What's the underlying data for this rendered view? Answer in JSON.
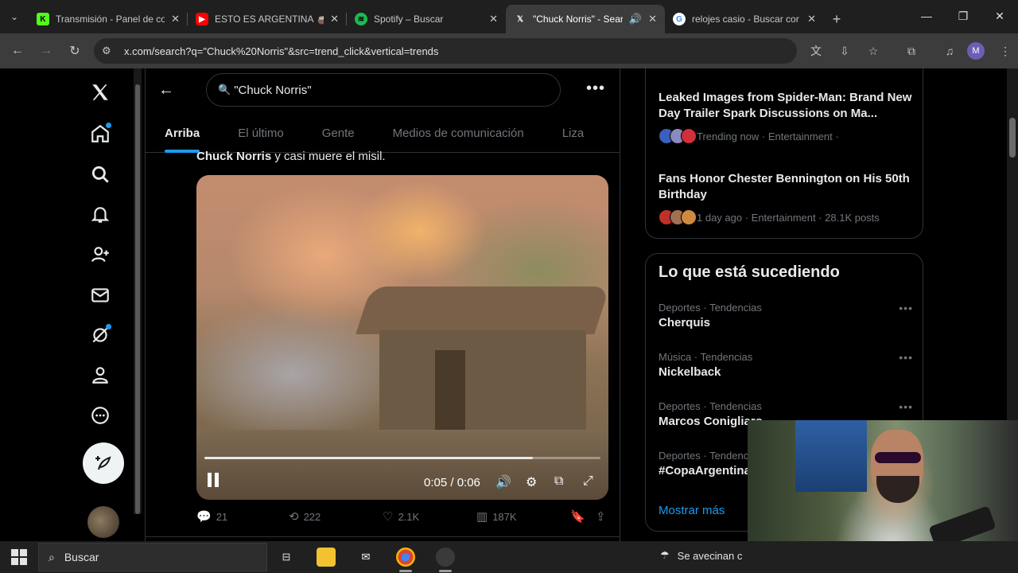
{
  "browser": {
    "tabs": [
      {
        "label": "Transmisión - Panel de co",
        "icon": "kick-icon",
        "color": "#53fc18",
        "active": false
      },
      {
        "label": "ESTO ES ARGENTINA 🧉🧉",
        "icon": "youtube-icon",
        "color": "#ff0000",
        "active": false
      },
      {
        "label": "Spotify – Buscar",
        "icon": "spotify-icon",
        "color": "#1db954",
        "active": false
      },
      {
        "label": "\"Chuck Norris\" - Sear",
        "icon": "x-icon",
        "color": "#ffffff",
        "active": true
      },
      {
        "label": "relojes casio - Buscar cor",
        "icon": "google-icon",
        "color": "#4285f4",
        "active": false
      }
    ],
    "url": "x.com/search?q=\"Chuck%20Norris\"&src=trend_click&vertical=trends",
    "profile_initial": "M"
  },
  "search": {
    "query": "\"Chuck Norris\"",
    "tabs": [
      "Arriba",
      "El último",
      "Gente",
      "Medios de comunicación",
      "Liza"
    ]
  },
  "post": {
    "text_bold": "Chuck Norris",
    "text_rest": " y casi muere el misil.",
    "video": {
      "time": "0:05 / 0:06",
      "progress": 0.83
    },
    "replies": "21",
    "reposts": "222",
    "likes": "2.1K",
    "views": "187K"
  },
  "news": [
    {
      "headline": "Leaked Images from Spider-Man: Brand New Day Trailer Spark Discussions on Ma...",
      "meta": "Trending now · Entertainment ·"
    },
    {
      "headline": "Fans Honor Chester Bennington on His 50th Birthday",
      "meta": "1 day ago · Entertainment · 28.1K posts"
    }
  ],
  "happening": {
    "title": "Lo que está sucediendo",
    "trends": [
      {
        "category": "Deportes · Tendencias",
        "name": "Cherquis"
      },
      {
        "category": "Música · Tendencias",
        "name": "Nickelback"
      },
      {
        "category": "Deportes · Tendencias",
        "name": "Marcos Conigliaro"
      },
      {
        "category": "Deportes · Tendencias",
        "name": "#CopaArgentina"
      }
    ],
    "show_more": "Mostrar más"
  },
  "taskbar": {
    "search_label": "Buscar",
    "weather_text": "Se avecinan c"
  },
  "colors": {
    "accent": "#1d9bf0",
    "background": "#000000"
  }
}
